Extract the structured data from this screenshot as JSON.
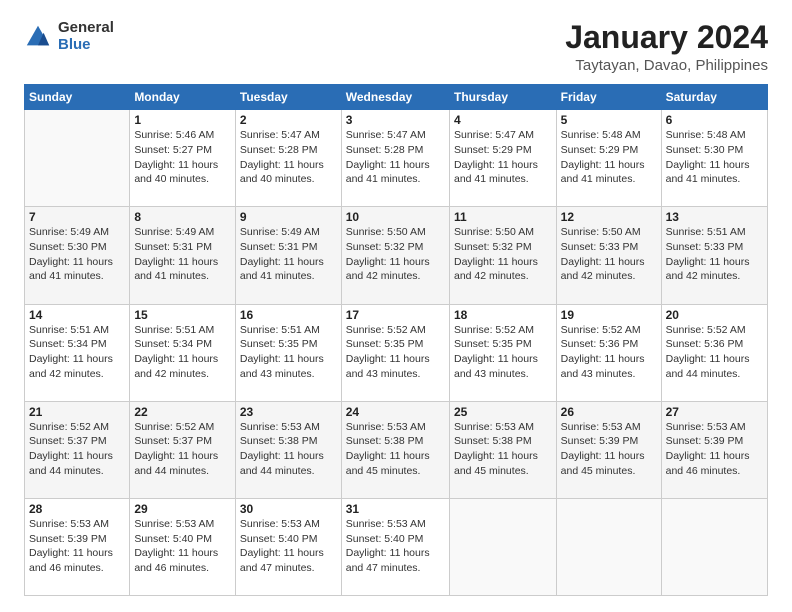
{
  "logo": {
    "general": "General",
    "blue": "Blue"
  },
  "header": {
    "title": "January 2024",
    "location": "Taytayan, Davao, Philippines"
  },
  "days_of_week": [
    "Sunday",
    "Monday",
    "Tuesday",
    "Wednesday",
    "Thursday",
    "Friday",
    "Saturday"
  ],
  "weeks": [
    [
      {
        "day": "",
        "info": ""
      },
      {
        "day": "1",
        "info": "Sunrise: 5:46 AM\nSunset: 5:27 PM\nDaylight: 11 hours\nand 40 minutes."
      },
      {
        "day": "2",
        "info": "Sunrise: 5:47 AM\nSunset: 5:28 PM\nDaylight: 11 hours\nand 40 minutes."
      },
      {
        "day": "3",
        "info": "Sunrise: 5:47 AM\nSunset: 5:28 PM\nDaylight: 11 hours\nand 41 minutes."
      },
      {
        "day": "4",
        "info": "Sunrise: 5:47 AM\nSunset: 5:29 PM\nDaylight: 11 hours\nand 41 minutes."
      },
      {
        "day": "5",
        "info": "Sunrise: 5:48 AM\nSunset: 5:29 PM\nDaylight: 11 hours\nand 41 minutes."
      },
      {
        "day": "6",
        "info": "Sunrise: 5:48 AM\nSunset: 5:30 PM\nDaylight: 11 hours\nand 41 minutes."
      }
    ],
    [
      {
        "day": "7",
        "info": "Sunrise: 5:49 AM\nSunset: 5:30 PM\nDaylight: 11 hours\nand 41 minutes."
      },
      {
        "day": "8",
        "info": "Sunrise: 5:49 AM\nSunset: 5:31 PM\nDaylight: 11 hours\nand 41 minutes."
      },
      {
        "day": "9",
        "info": "Sunrise: 5:49 AM\nSunset: 5:31 PM\nDaylight: 11 hours\nand 41 minutes."
      },
      {
        "day": "10",
        "info": "Sunrise: 5:50 AM\nSunset: 5:32 PM\nDaylight: 11 hours\nand 42 minutes."
      },
      {
        "day": "11",
        "info": "Sunrise: 5:50 AM\nSunset: 5:32 PM\nDaylight: 11 hours\nand 42 minutes."
      },
      {
        "day": "12",
        "info": "Sunrise: 5:50 AM\nSunset: 5:33 PM\nDaylight: 11 hours\nand 42 minutes."
      },
      {
        "day": "13",
        "info": "Sunrise: 5:51 AM\nSunset: 5:33 PM\nDaylight: 11 hours\nand 42 minutes."
      }
    ],
    [
      {
        "day": "14",
        "info": "Sunrise: 5:51 AM\nSunset: 5:34 PM\nDaylight: 11 hours\nand 42 minutes."
      },
      {
        "day": "15",
        "info": "Sunrise: 5:51 AM\nSunset: 5:34 PM\nDaylight: 11 hours\nand 42 minutes."
      },
      {
        "day": "16",
        "info": "Sunrise: 5:51 AM\nSunset: 5:35 PM\nDaylight: 11 hours\nand 43 minutes."
      },
      {
        "day": "17",
        "info": "Sunrise: 5:52 AM\nSunset: 5:35 PM\nDaylight: 11 hours\nand 43 minutes."
      },
      {
        "day": "18",
        "info": "Sunrise: 5:52 AM\nSunset: 5:35 PM\nDaylight: 11 hours\nand 43 minutes."
      },
      {
        "day": "19",
        "info": "Sunrise: 5:52 AM\nSunset: 5:36 PM\nDaylight: 11 hours\nand 43 minutes."
      },
      {
        "day": "20",
        "info": "Sunrise: 5:52 AM\nSunset: 5:36 PM\nDaylight: 11 hours\nand 44 minutes."
      }
    ],
    [
      {
        "day": "21",
        "info": "Sunrise: 5:52 AM\nSunset: 5:37 PM\nDaylight: 11 hours\nand 44 minutes."
      },
      {
        "day": "22",
        "info": "Sunrise: 5:52 AM\nSunset: 5:37 PM\nDaylight: 11 hours\nand 44 minutes."
      },
      {
        "day": "23",
        "info": "Sunrise: 5:53 AM\nSunset: 5:38 PM\nDaylight: 11 hours\nand 44 minutes."
      },
      {
        "day": "24",
        "info": "Sunrise: 5:53 AM\nSunset: 5:38 PM\nDaylight: 11 hours\nand 45 minutes."
      },
      {
        "day": "25",
        "info": "Sunrise: 5:53 AM\nSunset: 5:38 PM\nDaylight: 11 hours\nand 45 minutes."
      },
      {
        "day": "26",
        "info": "Sunrise: 5:53 AM\nSunset: 5:39 PM\nDaylight: 11 hours\nand 45 minutes."
      },
      {
        "day": "27",
        "info": "Sunrise: 5:53 AM\nSunset: 5:39 PM\nDaylight: 11 hours\nand 46 minutes."
      }
    ],
    [
      {
        "day": "28",
        "info": "Sunrise: 5:53 AM\nSunset: 5:39 PM\nDaylight: 11 hours\nand 46 minutes."
      },
      {
        "day": "29",
        "info": "Sunrise: 5:53 AM\nSunset: 5:40 PM\nDaylight: 11 hours\nand 46 minutes."
      },
      {
        "day": "30",
        "info": "Sunrise: 5:53 AM\nSunset: 5:40 PM\nDaylight: 11 hours\nand 47 minutes."
      },
      {
        "day": "31",
        "info": "Sunrise: 5:53 AM\nSunset: 5:40 PM\nDaylight: 11 hours\nand 47 minutes."
      },
      {
        "day": "",
        "info": ""
      },
      {
        "day": "",
        "info": ""
      },
      {
        "day": "",
        "info": ""
      }
    ]
  ]
}
